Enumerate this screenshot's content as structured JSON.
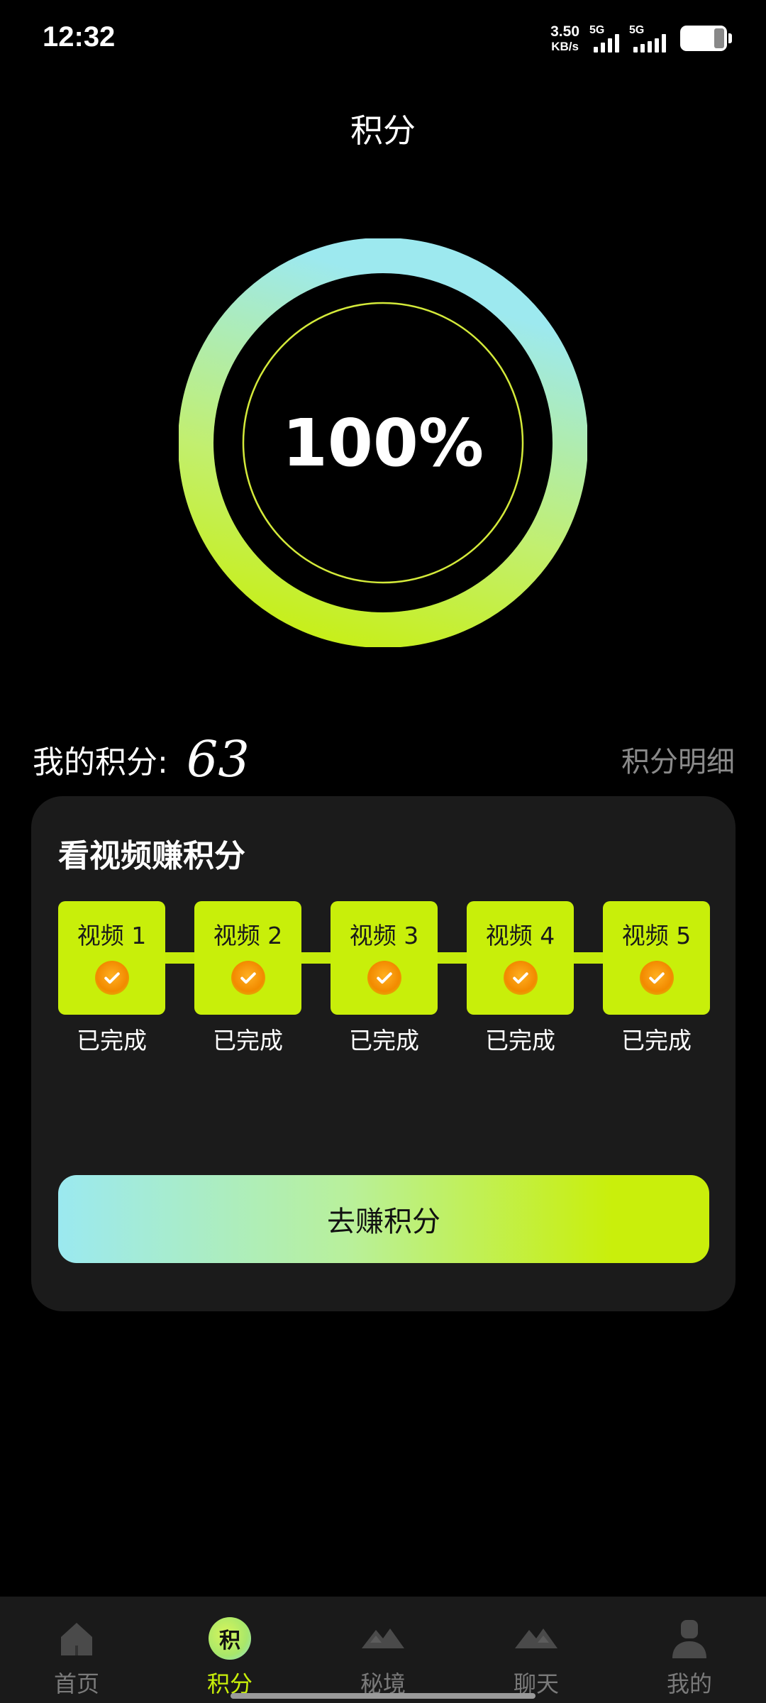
{
  "status_bar": {
    "time": "12:32",
    "net_speed_value": "3.50",
    "net_speed_unit": "KB/s",
    "signal1_label": "5G",
    "signal2_label": "5G"
  },
  "page": {
    "title": "积分"
  },
  "progress": {
    "percent_text": "100%",
    "fraction": 1.0
  },
  "points": {
    "label": "我的积分:",
    "value": "63",
    "detail_link": "积分明细"
  },
  "card": {
    "title": "看视频赚积分",
    "tasks": [
      {
        "label": "视频 1",
        "status": "已完成"
      },
      {
        "label": "视频 2",
        "status": "已完成"
      },
      {
        "label": "视频 3",
        "status": "已完成"
      },
      {
        "label": "视频 4",
        "status": "已完成"
      },
      {
        "label": "视频 5",
        "status": "已完成"
      }
    ],
    "button_label": "去赚积分"
  },
  "nav": {
    "items": [
      {
        "label": "首页",
        "icon": "home-icon"
      },
      {
        "label": "积分",
        "icon": "points-icon",
        "badge": "积",
        "active": true
      },
      {
        "label": "秘境",
        "icon": "mountain-icon"
      },
      {
        "label": "聊天",
        "icon": "chat-mountain-icon"
      },
      {
        "label": "我的",
        "icon": "profile-icon"
      }
    ]
  },
  "colors": {
    "accent_lime": "#c8ef0a",
    "accent_cyan": "#9be9f0",
    "background": "#000000",
    "card_bg": "#1b1b1b",
    "muted_text": "#8a8a8a"
  }
}
